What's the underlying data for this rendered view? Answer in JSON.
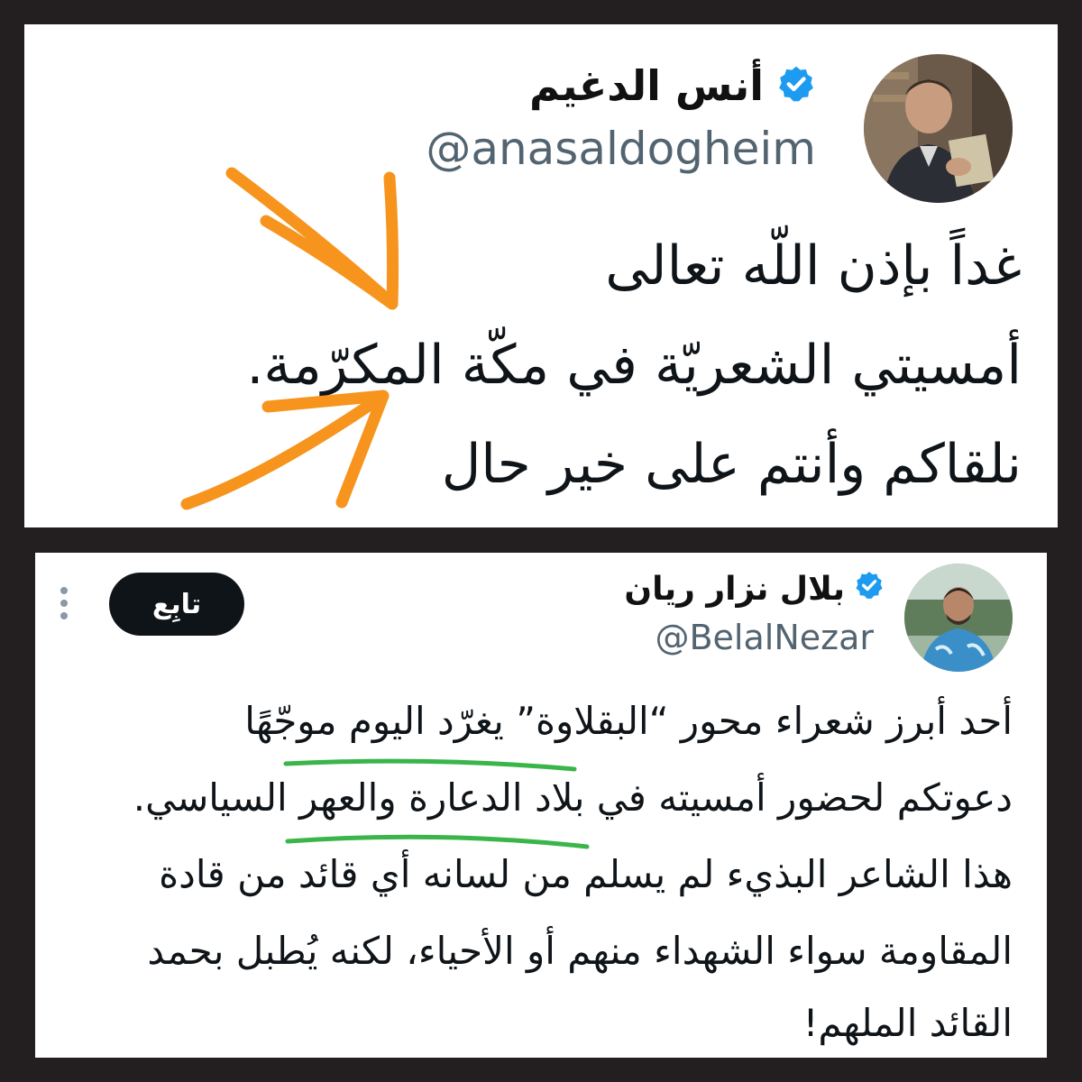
{
  "tweet1": {
    "author_name": "أنس الدغيم",
    "handle": "@anasaldogheim",
    "verified": true,
    "lines": [
      "غداً بإذن اللّه تعالى",
      "أمسيتي الشعريّة في مكّة المكرّمة.",
      "نلقاكم وأنتم على خير حال"
    ],
    "annotation_color": "#f7941d"
  },
  "tweet2": {
    "author_name": "بلال نزار ريان",
    "handle": "@BelalNezar",
    "verified": true,
    "follow_label": "تابِع",
    "lines": [
      "أحد أبرز شعراء محور “البقلاوة” يغرّد اليوم موجّهًا",
      "دعوتكم لحضور أمسيته في بلاد الدعارة والعهر السياسي.",
      "هذا الشاعر البذيء لم يسلم من لسانه أي قائد من قادة",
      "المقاومة سواء الشهداء منهم أو الأحياء، لكنه يُطبل بحمد",
      "القائد الملهم!"
    ],
    "annotation_color": "#39b54a"
  },
  "colors": {
    "verified_blue": "#1d9bf0",
    "background": "#231f20"
  }
}
